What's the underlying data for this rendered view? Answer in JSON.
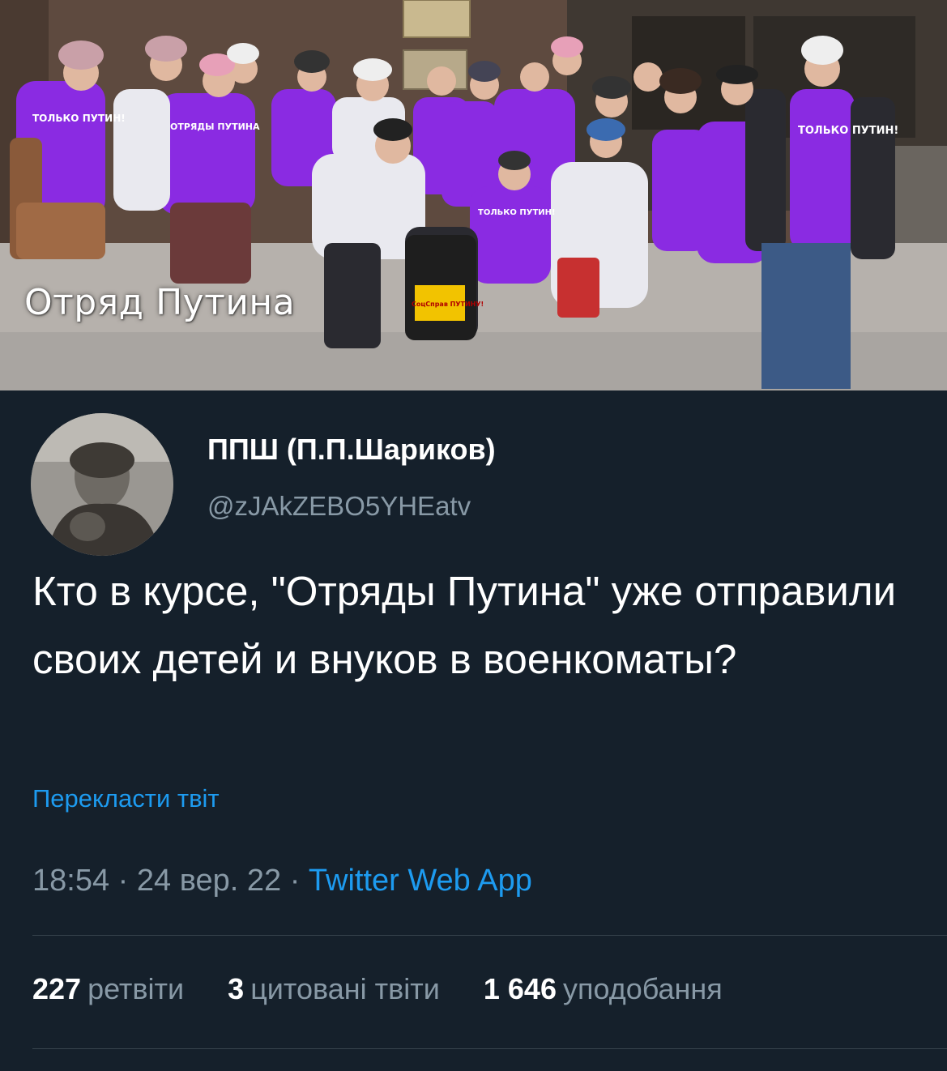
{
  "photo": {
    "caption": "Отряд Путина",
    "shirt_texts": [
      "ТОЛЬКО ПУТИН!",
      "ОТРЯДЫ ПУТИНА",
      "СоцСправ ПУТИНУ!"
    ]
  },
  "tweet": {
    "display_name": "ППШ (П.П.Шариков)",
    "handle": "@zJAkZEBO5YHEatv",
    "text": "Кто в курсе, \"Отряды Путина\" уже отправили своих детей и внуков в военкоматы?",
    "translate_label": "Перекласти твіт",
    "time": "18:54",
    "date": "24 вер. 22",
    "separator": "·",
    "source": "Twitter Web App",
    "stats": [
      {
        "count": "227",
        "label": "ретвіти"
      },
      {
        "count": "3",
        "label": "цитовані твіти"
      },
      {
        "count": "1 646",
        "label": "уподобання"
      }
    ]
  },
  "colors": {
    "background": "#15202b",
    "secondary_text": "#8899a6",
    "link": "#1d9bf0",
    "shirt_purple": "#8a2be2"
  }
}
